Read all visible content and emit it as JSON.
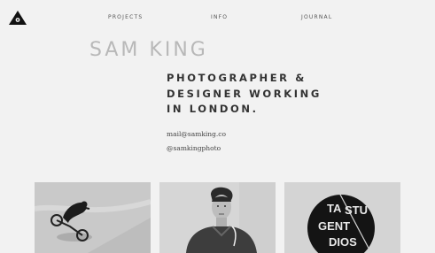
{
  "nav": {
    "projects": "PROJECTS",
    "info": "INFO",
    "journal": "JOURNAL"
  },
  "hero": {
    "name": "SAM KING",
    "tagline": "PHOTOGRAPHER & DESIGNER WORKING IN LONDON."
  },
  "contact": {
    "email": "mail@samking.co",
    "handle": "@samkingphoto"
  },
  "portfolio": {
    "tiles": [
      {
        "subject": "bmx-rider-photo"
      },
      {
        "subject": "portrait-photo"
      },
      {
        "subject": "badge-graphic",
        "badge_lines": [
          "TA",
          "STU",
          "GENT",
          "DIOS"
        ]
      }
    ]
  },
  "colors": {
    "background": "#f2f2f2",
    "name": "#b8b8b8",
    "text": "#333333"
  }
}
